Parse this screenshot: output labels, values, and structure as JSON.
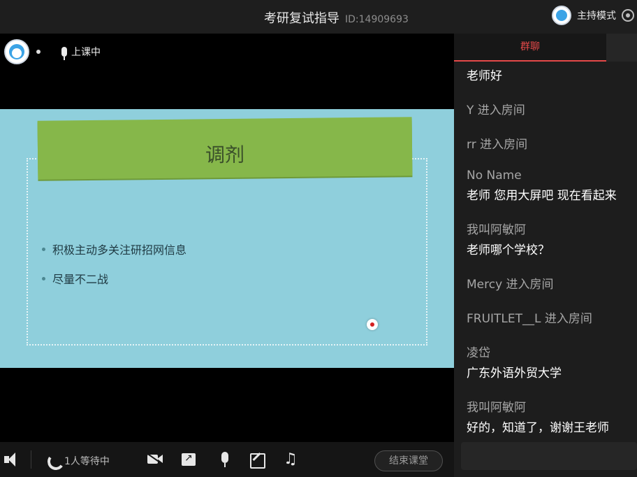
{
  "header": {
    "title": "考研复试指导",
    "room_id": "ID:14909693",
    "host_mode_label": "主持模式"
  },
  "stage": {
    "status_label": "上课中",
    "slide": {
      "title": "调剂",
      "bullets": [
        "积极主动多关注研招网信息",
        "尽量不二战"
      ]
    }
  },
  "toolbar": {
    "waiting_label": "1人等待中",
    "end_class_label": "结束课堂"
  },
  "chat": {
    "tab_label": "群聊",
    "lines": [
      {
        "kind": "text",
        "text": "老师好"
      },
      {
        "kind": "system",
        "text": "Y 进入房间"
      },
      {
        "kind": "system",
        "text": "rr 进入房间"
      },
      {
        "kind": "sender",
        "text": "No Name"
      },
      {
        "kind": "text",
        "text": "老师 您用大屏吧  现在看起来"
      },
      {
        "kind": "sender",
        "text": "我叫阿敏阿"
      },
      {
        "kind": "text",
        "text": "老师哪个学校？"
      },
      {
        "kind": "system",
        "text": "Mercy 进入房间"
      },
      {
        "kind": "system",
        "text": "FRUITLET__L 进入房间"
      },
      {
        "kind": "sender",
        "text": "凌岱"
      },
      {
        "kind": "text",
        "text": "广东外语外贸大学"
      },
      {
        "kind": "sender",
        "text": "我叫阿敏阿"
      },
      {
        "kind": "text",
        "text": "好的，知道了，谢谢王老师"
      }
    ]
  },
  "colors": {
    "accent": "#e54949",
    "slide_bg": "#8fcfdc",
    "banner": "#86b74a"
  },
  "icons": [
    "settings-icon",
    "speaker-icon",
    "phone-icon",
    "video-off-icon",
    "share-screen-icon",
    "microphone-icon",
    "edit-icon",
    "music-icon"
  ]
}
